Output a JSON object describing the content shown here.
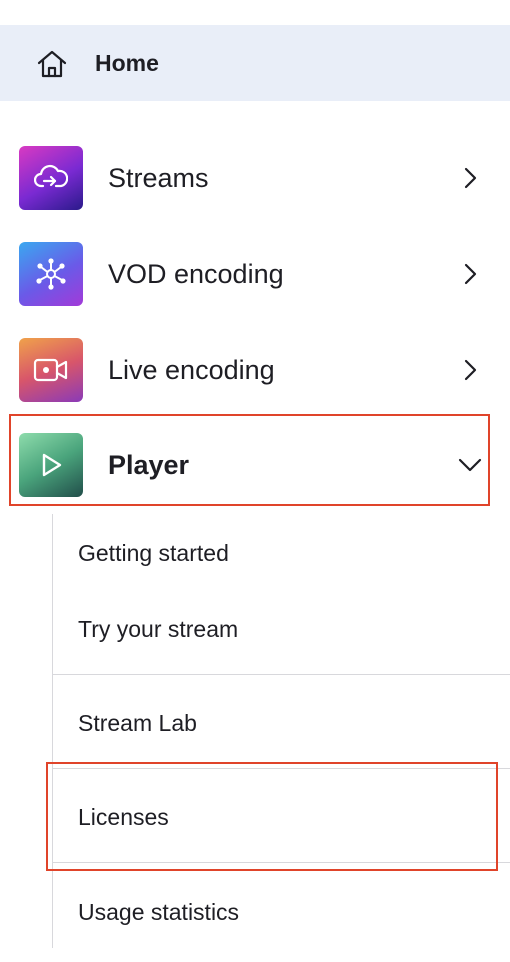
{
  "home": {
    "label": "Home",
    "icon": "house-icon"
  },
  "nav": {
    "items": [
      {
        "label": "Streams",
        "icon": "cloud-upload-icon",
        "state": "collapsed"
      },
      {
        "label": "VOD encoding",
        "icon": "network-hub-icon",
        "state": "collapsed"
      },
      {
        "label": "Live encoding",
        "icon": "video-camera-icon",
        "state": "collapsed"
      },
      {
        "label": "Player",
        "icon": "play-icon",
        "state": "expanded"
      }
    ]
  },
  "player_submenu": {
    "items": [
      {
        "label": "Getting started"
      },
      {
        "label": "Try your stream"
      },
      {
        "label": "Stream Lab"
      },
      {
        "label": "Licenses"
      },
      {
        "label": "Usage statistics"
      }
    ]
  },
  "colors": {
    "highlight": "#e0442a",
    "home_background": "#e9eef8",
    "text": "#1e1e24",
    "divider": "#d8d8dc"
  }
}
